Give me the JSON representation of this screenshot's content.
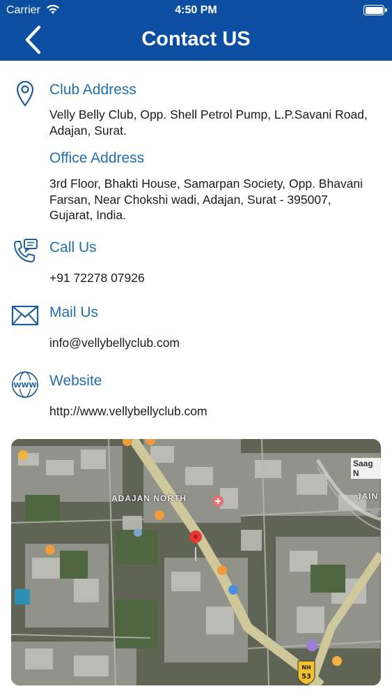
{
  "status_bar": {
    "carrier": "Carrier",
    "time": "4:50 PM"
  },
  "header": {
    "title": "Contact US",
    "back_icon": "chevron-left-icon"
  },
  "club_address": {
    "title": "Club Address",
    "text": "Velly Belly Club, Opp. Shell Petrol Pump, L.P.Savani Road, Adajan, Surat.",
    "icon": "location-pin-icon"
  },
  "office_address": {
    "title": "Office Address",
    "text": "3rd Floor, Bhakti House, Samarpan Society, Opp. Bhavani Farsan, Near Chokshi wadi, Adajan, Surat - 395007, Gujarat, India."
  },
  "call": {
    "title": "Call Us",
    "text": "+91 72278 07926",
    "icon": "phone-chat-icon"
  },
  "mail": {
    "title": "Mail Us",
    "text": "info@vellybellyclub.com",
    "icon": "envelope-icon"
  },
  "website": {
    "title": "Website",
    "text": "http://www.vellybellyclub.com",
    "icon": "www-globe-icon",
    "icon_text": "WWW"
  },
  "map": {
    "labels": {
      "area": "ADAJAN NORTH",
      "jain": "JAIN",
      "saag": "Saag N",
      "nh": "NH",
      "nh_num": "53"
    },
    "colors": {
      "accent": "#0b4ea2",
      "title_blue": "#1f6fb0",
      "pin": "#e53935"
    }
  }
}
